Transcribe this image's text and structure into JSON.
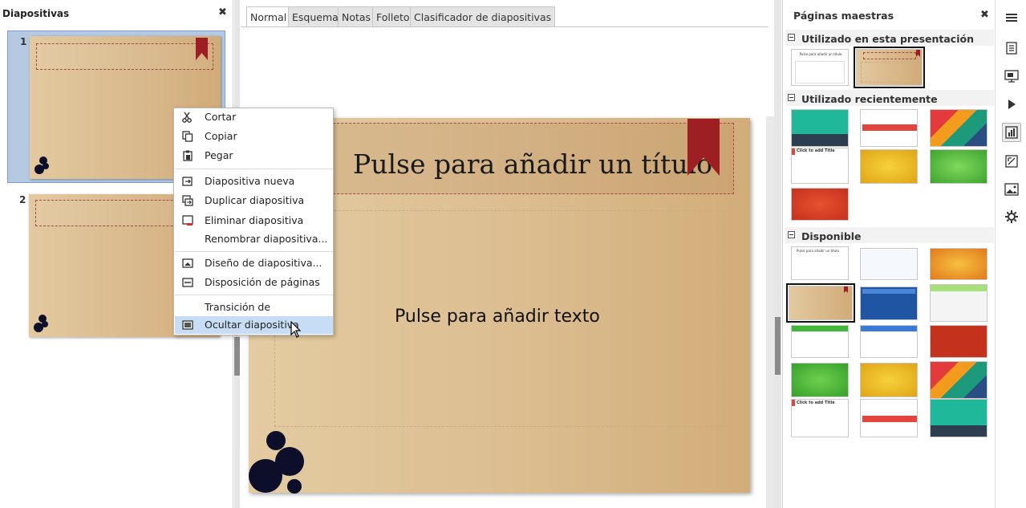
{
  "slides_pane": {
    "title": "Diapositivas",
    "close_label": "✖",
    "slides": [
      {
        "number": "1"
      },
      {
        "number": "2"
      }
    ]
  },
  "tabs": [
    "Normal",
    "Esquema",
    "Notas",
    "Folleto",
    "Clasificador de diapositivas"
  ],
  "active_tab": "Normal",
  "slide": {
    "title_placeholder": "Pulse para añadir un título",
    "body_placeholder": "Pulse para añadir texto"
  },
  "context_menu": {
    "items": [
      {
        "label": "Cortar",
        "icon": "scissors-icon"
      },
      {
        "label": "Copiar",
        "icon": "copy-icon"
      },
      {
        "label": "Pegar",
        "icon": "paste-icon"
      },
      {
        "label": "Diapositiva nueva",
        "icon": "new-slide-icon"
      },
      {
        "label": "Duplicar diapositiva",
        "icon": "duplicate-slide-icon"
      },
      {
        "label": "Eliminar diapositiva",
        "icon": "delete-slide-icon"
      },
      {
        "label": "Renombrar diapositiva...",
        "icon": ""
      },
      {
        "label": "Diseño de diapositiva...",
        "icon": "slide-design-icon"
      },
      {
        "label": "Disposición de páginas",
        "icon": "page-layout-icon"
      },
      {
        "label": "Transición de diapositivas",
        "icon": ""
      },
      {
        "label": "Ocultar diapositiva",
        "icon": "hide-slide-icon"
      }
    ],
    "highlighted": "Ocultar diapositiva"
  },
  "master_pages": {
    "title": "Páginas maestras",
    "close_label": "✖",
    "sections": {
      "used": "Utilizado en esta presentación",
      "recent": "Utilizado recientemente",
      "available": "Disponible"
    },
    "thumb_text": {
      "title_es": "Pulse para añadir un título",
      "click_title": "Click to add title",
      "click_add_title": "Click to add Title",
      "click_text": "Click to add text"
    }
  },
  "sidebar_icons": [
    "menu-icon",
    "properties-icon",
    "slide-transition-icon",
    "animation-icon",
    "master-slides-icon",
    "styles-icon",
    "gallery-icon",
    "navigator-icon"
  ],
  "colors": {
    "selection": "#b5c9e3",
    "menu_highlight": "#c6ddf5",
    "ribbon": "#9e1f23",
    "slide_bg": "#dbbd90"
  }
}
